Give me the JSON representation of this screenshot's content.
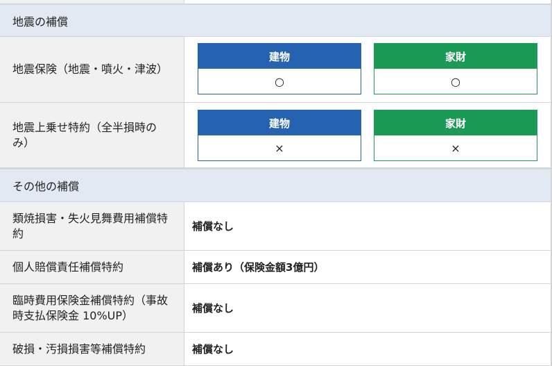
{
  "sections": {
    "earthquake": "地震の補償",
    "other": "その他の補償"
  },
  "earthquake_rows": [
    {
      "label": "地震保険（地震・噴火・津波）",
      "building": {
        "header": "建物",
        "value": "○"
      },
      "contents": {
        "header": "家財",
        "value": "○"
      }
    },
    {
      "label": "地震上乗せ特約（全半損時のみ）",
      "building": {
        "header": "建物",
        "value": "×"
      },
      "contents": {
        "header": "家財",
        "value": "×"
      }
    }
  ],
  "other_rows": [
    {
      "label": "類焼損害・失火見舞費用補償特約",
      "value": "補償なし"
    },
    {
      "label": "個人賠償責任補償特約",
      "value": "補償あり（保険金額3億円）"
    },
    {
      "label": "臨時費用保険金補償特約（事故時支払保険金 10%UP）",
      "value": "補償なし"
    },
    {
      "label": "破損・汚損損害等補償特約",
      "value": "補償なし"
    }
  ],
  "colors": {
    "building_header": "#2563b0",
    "contents_header": "#1b9a55",
    "section_bg": "#e3e9f2",
    "label_bg": "#f1f1f1"
  }
}
